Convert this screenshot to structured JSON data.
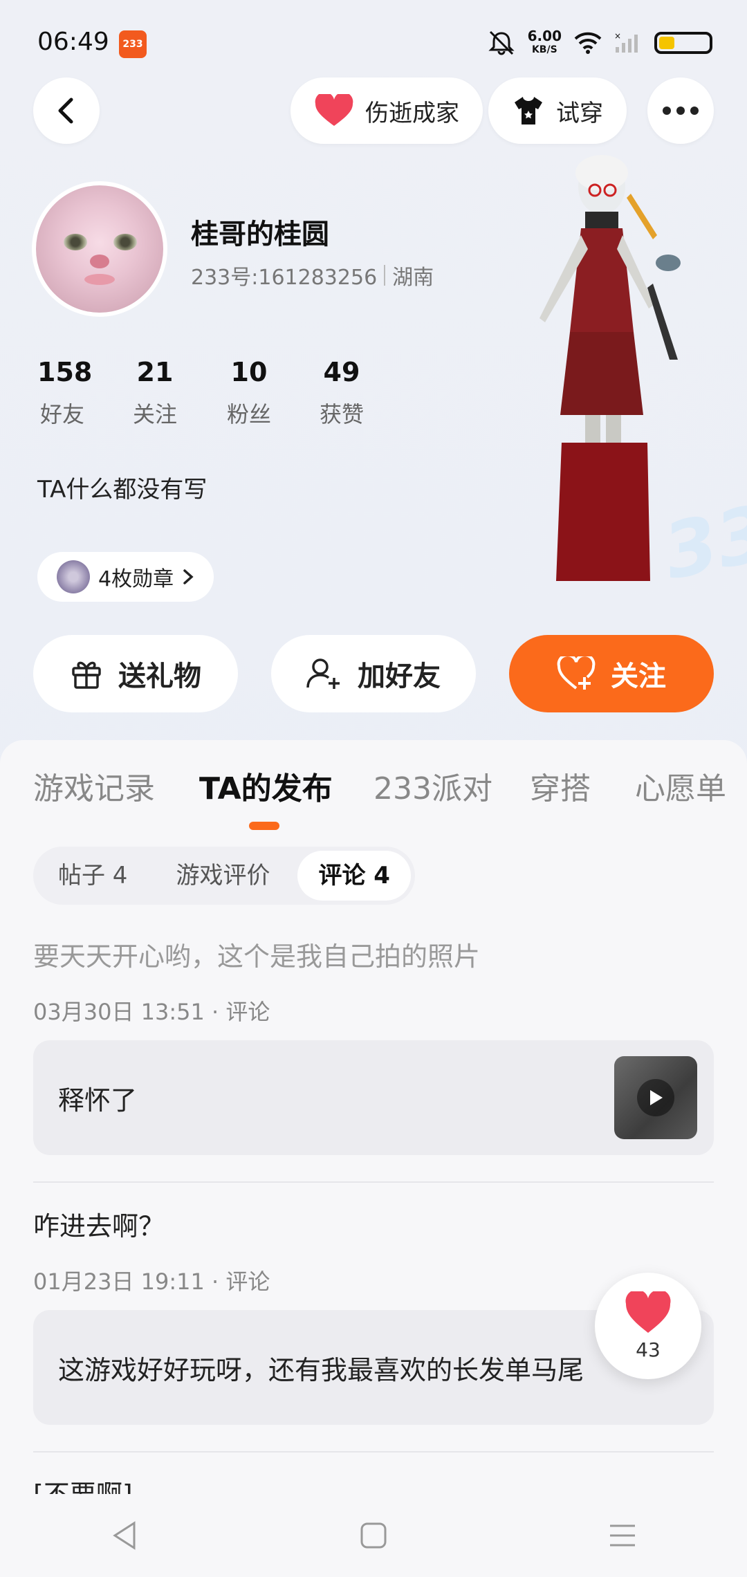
{
  "status_bar": {
    "time": "06:49",
    "app_badge": "233",
    "net_speed_value": "6.00",
    "net_speed_unit": "KB/S"
  },
  "header": {
    "relation_label": "伤逝成家",
    "try_on_label": "试穿"
  },
  "profile": {
    "username": "桂哥的桂圆",
    "id_text": "233号:161283256",
    "location": "湖南",
    "bio": "TA什么都没有写",
    "medal_label": "4枚勋章",
    "stats": [
      {
        "value": "158",
        "label": "好友"
      },
      {
        "value": "21",
        "label": "关注"
      },
      {
        "value": "10",
        "label": "粉丝"
      },
      {
        "value": "49",
        "label": "获赞"
      }
    ]
  },
  "actions": {
    "gift": "送礼物",
    "add_friend": "加好友",
    "follow": "关注"
  },
  "tabs": [
    "游戏记录",
    "TA的发布",
    "233派对",
    "穿搭",
    "心愿单"
  ],
  "active_tab": "TA的发布",
  "subtabs": [
    "帖子 4",
    "游戏评价",
    "评论 4"
  ],
  "active_subtab": "评论 4",
  "posts": [
    {
      "title": "要天天开心哟，这个是我自己拍的照片",
      "meta": "03月30日 13:51 · 评论",
      "body": "释怀了"
    },
    {
      "title": "咋进去啊？",
      "meta": "01月23日 19:11 · 评论",
      "body": "这游戏好好玩呀，还有我最喜欢的长发单马尾"
    },
    {
      "title": "[不要啊]"
    }
  ],
  "like_fab": {
    "count": "43"
  },
  "colors": {
    "accent": "#fb6a1b",
    "heart": "#f0445a"
  }
}
